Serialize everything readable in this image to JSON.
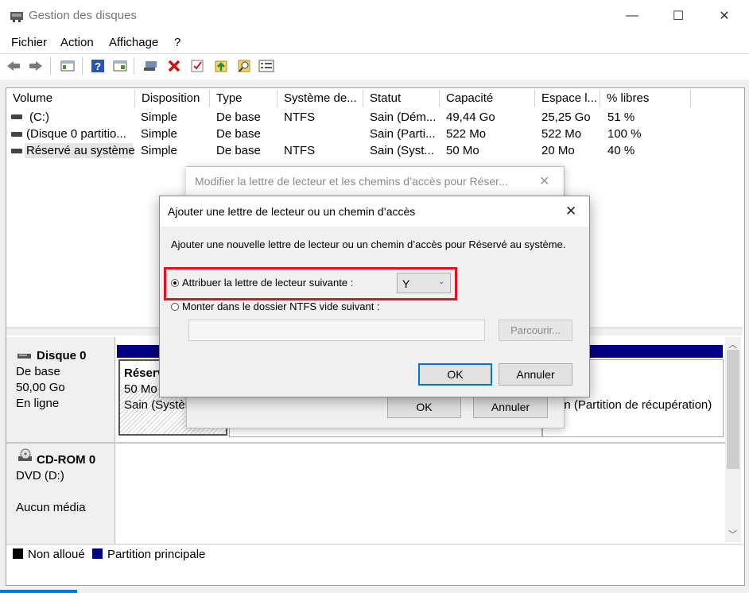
{
  "window": {
    "title": "Gestion des disques",
    "minimize_glyph": "—",
    "maximize_glyph": "☐",
    "close_glyph": "✕"
  },
  "menu": [
    "Fichier",
    "Action",
    "Affichage",
    "?"
  ],
  "toolbar_icons": [
    "back-icon",
    "forward-icon",
    "console-tree-icon",
    "help-icon",
    "properties-icon",
    "connect-icon",
    "delete-icon",
    "check-icon",
    "export-icon",
    "search-icon",
    "list-icon"
  ],
  "volume_table": {
    "headers": [
      "Volume",
      "Disposition",
      "Type",
      "Système de...",
      "Statut",
      "Capacité",
      "Espace l...",
      "% libres"
    ],
    "rows": [
      [
        "(C:)",
        "Simple",
        "De base",
        "NTFS",
        "Sain (Dém...",
        "49,44 Go",
        "25,25 Go",
        "51 %"
      ],
      [
        "(Disque 0 partitio...",
        "Simple",
        "De base",
        "",
        "Sain (Parti...",
        "522 Mo",
        "522 Mo",
        "100 %"
      ],
      [
        "Réservé au système",
        "Simple",
        "De base",
        "NTFS",
        "Sain (Syst...",
        "50 Mo",
        "20 Mo",
        "40 %"
      ]
    ]
  },
  "disks": {
    "disk0": {
      "name": "Disque 0",
      "type": "De base",
      "size": "50,00 Go",
      "status": "En ligne",
      "part1_name": "Réserv",
      "part1_size": "50 Mo",
      "part1_status": "Sain (Systèn",
      "part3_status": "in (Partition de récupération)"
    },
    "cdrom0": {
      "name": "CD-ROM 0",
      "type": "DVD (D:)",
      "status": "Aucun média"
    }
  },
  "legend": [
    {
      "label": "Non alloué",
      "color": "#000000"
    },
    {
      "label": "Partition principale",
      "color": "#000080"
    }
  ],
  "dialog_back": {
    "title": "Modifier la lettre de lecteur et les chemins d’accès pour Réser...",
    "ok": "OK",
    "cancel": "Annuler"
  },
  "dialog_front": {
    "title": "Ajouter une lettre de lecteur ou un chemin d’accès",
    "description": "Ajouter une nouvelle lettre de lecteur ou un chemin d’accès pour Réservé au système.",
    "option_assign": "Attribuer la lettre de lecteur suivante :",
    "drive_letter": "Y",
    "option_mount": "Monter dans le dossier NTFS vide suivant :",
    "mount_path": "",
    "browse": "Parcourir...",
    "ok": "OK",
    "cancel": "Annuler"
  },
  "colors": {
    "highlight": "#e81123",
    "partition_bar": "#000080",
    "accent": "#0078d7"
  }
}
